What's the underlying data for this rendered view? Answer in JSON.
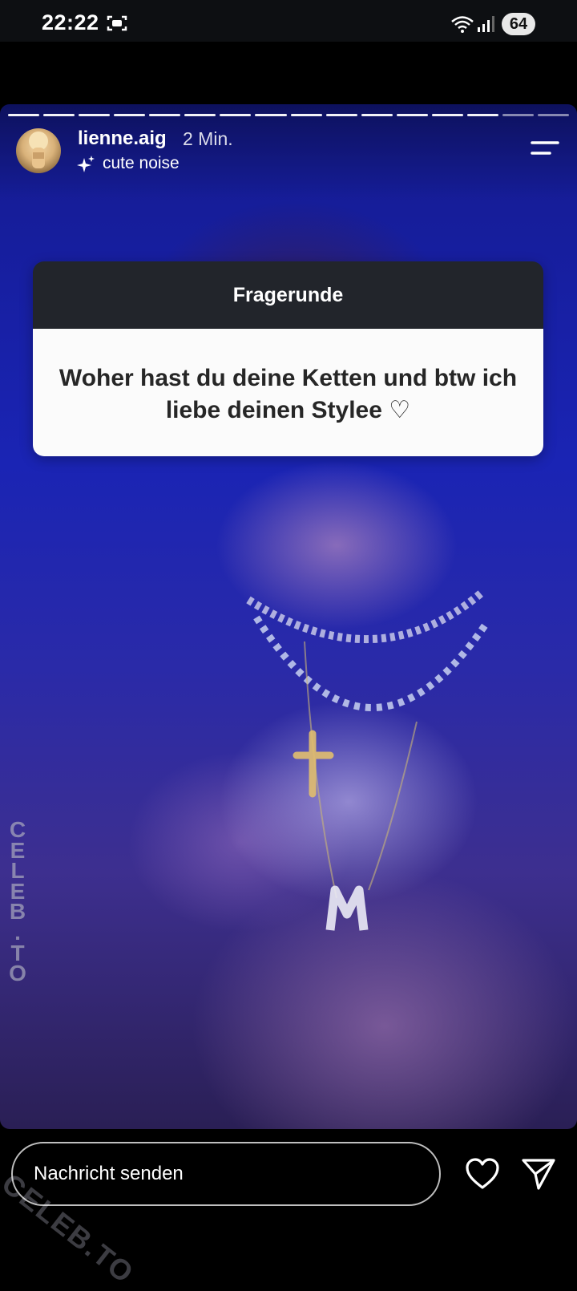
{
  "status_bar": {
    "time": "22:22",
    "battery": "64"
  },
  "story": {
    "username": "lienne.aig",
    "time_ago": "2 Min.",
    "audio": "cute noise",
    "progress_segments_total": 16,
    "progress_segments_done": 14
  },
  "question_sticker": {
    "title": "Fragerunde",
    "question": "Woher hast du deine Ketten und btw ich liebe deinen Stylee ♡"
  },
  "watermark": {
    "vertical": "CELEB.TO",
    "diagonal": "CELEB.TO"
  },
  "reply_bar": {
    "placeholder": "Nachricht senden"
  },
  "icons": [
    "screenshot-icon",
    "wifi-icon",
    "signal-icon",
    "sparkle-icon",
    "menu-icon",
    "heart-icon",
    "send-icon"
  ]
}
